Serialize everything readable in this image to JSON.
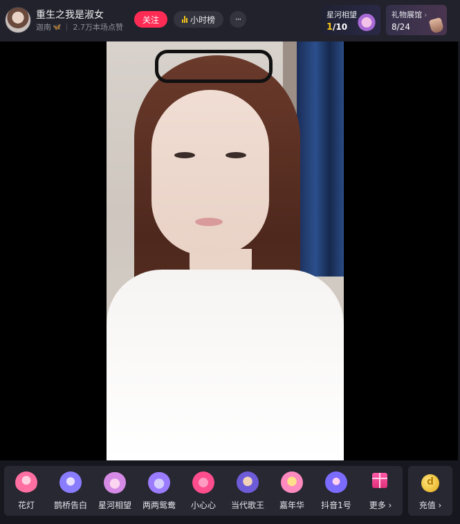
{
  "header": {
    "host_name": "重生之我是淑女",
    "sub_name": "迦南",
    "sub_badge_icon": "butterfly-icon",
    "likes_text": "2.7万本场点赞",
    "follow_label": "关注",
    "rank_label": "小时榜",
    "more_label": "···"
  },
  "wish": {
    "title": "星河相望",
    "current": "1",
    "total": "/10"
  },
  "gallery": {
    "title": "礼物展馆",
    "chevron": "›",
    "count": "8/24"
  },
  "gifts": [
    {
      "label": "花灯",
      "icon": "lantern-icon",
      "color": "#ff6fa2"
    },
    {
      "label": "鹊桥告白",
      "icon": "magpie-bridge-icon",
      "color": "#8a7cff"
    },
    {
      "label": "星河相望",
      "icon": "galaxy-icon",
      "color": "#d58ae6"
    },
    {
      "label": "两两鸳鸯",
      "icon": "mandarin-ducks-icon",
      "color": "#9b7cff"
    },
    {
      "label": "小心心",
      "icon": "heart-icon",
      "color": "#ff4d8d"
    },
    {
      "label": "当代歌王",
      "icon": "singer-icon",
      "color": "#6d5bd8"
    },
    {
      "label": "嘉年华",
      "icon": "carnival-icon",
      "color": "#ff8ac0"
    },
    {
      "label": "抖音1号",
      "icon": "rocket-icon",
      "color": "#7b6cff"
    },
    {
      "label": "更多 ›",
      "icon": "gift-box-icon",
      "color": "#ff4da6"
    }
  ],
  "recharge": {
    "label": "充值 ›",
    "icon": "coin-icon"
  }
}
